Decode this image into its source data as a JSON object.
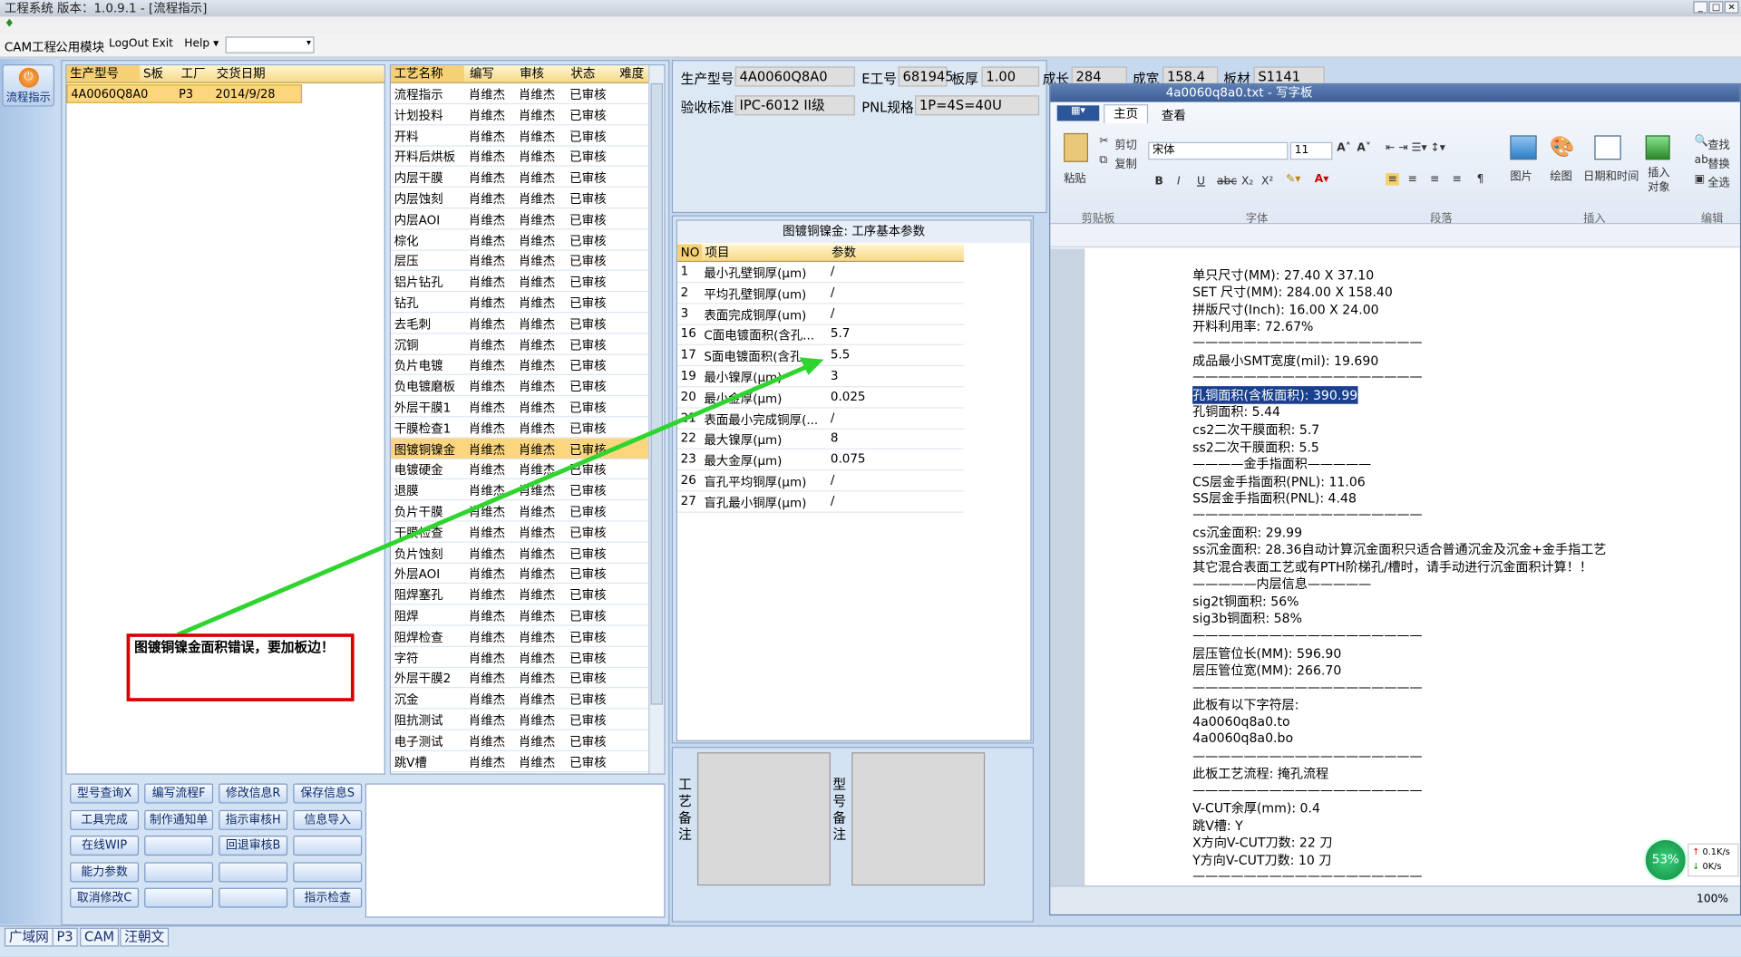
{
  "window": {
    "title": "工程系统    版本：1.0.9.1 - [流程指示]"
  },
  "menu": [
    "CAM工程",
    "公用模块",
    "LogOut",
    "Exit",
    "Help ▾"
  ],
  "sidebar": {
    "flow_button": "流程指示"
  },
  "order_grid": {
    "headers": [
      "生产型号",
      "S板",
      "工厂",
      "交货日期"
    ],
    "rows": [
      [
        "4A0060Q8A0",
        "",
        "P3",
        "2014/9/28"
      ]
    ]
  },
  "process_grid": {
    "headers": [
      "工艺名称",
      "编写",
      "审核",
      "状态",
      "难度"
    ],
    "rows": [
      [
        "流程指示",
        "肖维杰",
        "肖维杰",
        "已审核"
      ],
      [
        "计划投料",
        "肖维杰",
        "肖维杰",
        "已审核"
      ],
      [
        "开料",
        "肖维杰",
        "肖维杰",
        "已审核"
      ],
      [
        "开料后烘板",
        "肖维杰",
        "肖维杰",
        "已审核"
      ],
      [
        "内层干膜",
        "肖维杰",
        "肖维杰",
        "已审核"
      ],
      [
        "内层蚀刻",
        "肖维杰",
        "肖维杰",
        "已审核"
      ],
      [
        "内层AOI",
        "肖维杰",
        "肖维杰",
        "已审核"
      ],
      [
        "棕化",
        "肖维杰",
        "肖维杰",
        "已审核"
      ],
      [
        "层压",
        "肖维杰",
        "肖维杰",
        "已审核"
      ],
      [
        "铝片钻孔",
        "肖维杰",
        "肖维杰",
        "已审核"
      ],
      [
        "钻孔",
        "肖维杰",
        "肖维杰",
        "已审核"
      ],
      [
        "去毛刺",
        "肖维杰",
        "肖维杰",
        "已审核"
      ],
      [
        "沉铜",
        "肖维杰",
        "肖维杰",
        "已审核"
      ],
      [
        "负片电镀",
        "肖维杰",
        "肖维杰",
        "已审核"
      ],
      [
        "负电镀磨板",
        "肖维杰",
        "肖维杰",
        "已审核"
      ],
      [
        "外层干膜1",
        "肖维杰",
        "肖维杰",
        "已审核"
      ],
      [
        "干膜检查1",
        "肖维杰",
        "肖维杰",
        "已审核"
      ],
      [
        "图镀铜镍金",
        "肖维杰",
        "肖维杰",
        "已审核"
      ],
      [
        "电镀硬金",
        "肖维杰",
        "肖维杰",
        "已审核"
      ],
      [
        "退膜",
        "肖维杰",
        "肖维杰",
        "已审核"
      ],
      [
        "负片干膜",
        "肖维杰",
        "肖维杰",
        "已审核"
      ],
      [
        "干膜检查",
        "肖维杰",
        "肖维杰",
        "已审核"
      ],
      [
        "负片蚀刻",
        "肖维杰",
        "肖维杰",
        "已审核"
      ],
      [
        "外层AOI",
        "肖维杰",
        "肖维杰",
        "已审核"
      ],
      [
        "阻焊塞孔",
        "肖维杰",
        "肖维杰",
        "已审核"
      ],
      [
        "阻焊",
        "肖维杰",
        "肖维杰",
        "已审核"
      ],
      [
        "阻焊检查",
        "肖维杰",
        "肖维杰",
        "已审核"
      ],
      [
        "字符",
        "肖维杰",
        "肖维杰",
        "已审核"
      ],
      [
        "外层干膜2",
        "肖维杰",
        "肖维杰",
        "已审核"
      ],
      [
        "沉金",
        "肖维杰",
        "肖维杰",
        "已审核"
      ],
      [
        "阻抗测试",
        "肖维杰",
        "肖维杰",
        "已审核"
      ],
      [
        "电子测试",
        "肖维杰",
        "肖维杰",
        "已审核"
      ],
      [
        "跳V槽",
        "肖维杰",
        "肖维杰",
        "已审核"
      ]
    ],
    "selected": "图镀铜镍金"
  },
  "buttons": [
    [
      "型号查询X",
      "编写流程F",
      "修改信息R",
      "保存信息S"
    ],
    [
      "工具完成",
      "制作通知单",
      "指示审核H",
      "信息导入"
    ],
    [
      "在线WIP",
      "",
      "回退审核B",
      ""
    ],
    [
      "能力参数",
      "",
      "",
      ""
    ],
    [
      "取消修改C",
      "",
      "",
      "指示检查"
    ]
  ],
  "info": {
    "model_label": "生产型号",
    "model": "4A0060Q8A0",
    "eno_label": "E工号",
    "eno": "681945",
    "thick_label": "板厚",
    "thick": "1.00",
    "len_label": "成长",
    "len": "284",
    "width_label": "成宽",
    "width": "158.4",
    "mat_label": "板材",
    "mat": "S1141",
    "std_label": "验收标准",
    "std": "IPC-6012 II级",
    "pnl_label": "PNL规格",
    "pnl": "1P=4S=40U"
  },
  "params": {
    "title": "图镀铜镍金: 工序基本参数",
    "headers": [
      "NO",
      "项目",
      "参数"
    ],
    "rows": [
      [
        "1",
        "最小孔壁铜厚(μm)",
        "/"
      ],
      [
        "2",
        "平均孔壁铜厚(um)",
        "/"
      ],
      [
        "3",
        "表面完成铜厚(um)",
        "/"
      ],
      [
        "16",
        "C面电镀面积(含孔...",
        "5.7"
      ],
      [
        "17",
        "S面电镀面积(含孔...",
        "5.5"
      ],
      [
        "19",
        "最小镍厚(μm)",
        "3"
      ],
      [
        "20",
        "最小金厚(μm)",
        "0.025"
      ],
      [
        "21",
        "表面最小完成铜厚(...",
        "/"
      ],
      [
        "22",
        "最大镍厚(μm)",
        "8"
      ],
      [
        "23",
        "最大金厚(μm)",
        "0.075"
      ],
      [
        "26",
        "盲孔平均铜厚(μm)",
        "/"
      ],
      [
        "27",
        "盲孔最小铜厚(μm)",
        "/"
      ]
    ]
  },
  "remarks": {
    "process": "工艺备注",
    "model": "型号备注"
  },
  "annotation": "图镀铜镍金面积错误，要加板边！",
  "wordpad": {
    "title": "4a0060q8a0.txt - 写字板",
    "tabs": [
      "主页",
      "查看"
    ],
    "clipboard": {
      "paste": "粘贴",
      "cut": "剪切",
      "copy": "复制",
      "group": "剪贴板"
    },
    "font": {
      "name": "宋体",
      "size": "11",
      "group": "字体"
    },
    "paragraph": "段落",
    "insert": {
      "pic": "图片",
      "draw": "绘图",
      "datetime": "日期和时间",
      "obj": "插入对象",
      "group": "插入"
    },
    "edit": {
      "find": "查找",
      "replace": "替换",
      "all": "全选",
      "group": "编辑"
    },
    "zoom": "100%",
    "lines": [
      "单只尺寸(MM): 27.40 X 37.10",
      "SET 尺寸(MM): 284.00 X 158.40",
      "拼版尺寸(Inch): 16.00 X 24.00",
      "开料利用率: 72.67%",
      "——————————————————",
      "成品最小SMT宽度(mil): 19.690",
      "——————————————————",
      "孔铜面积(含板面积): 390.99",
      "孔铜面积: 5.44",
      "cs2二次干膜面积: 5.7",
      "ss2二次干膜面积: 5.5",
      "————金手指面积—————",
      "CS层金手指面积(PNL): 11.06",
      "SS层金手指面积(PNL): 4.48",
      "——————————————————",
      "cs沉金面积: 29.99",
      "ss沉金面积: 28.36自动计算沉金面积只适合普通沉金及沉金+金手指工艺",
      "其它混合表面工艺或有PTH阶梯孔/槽时，请手动进行沉金面积计算！！",
      "—————内层信息—————",
      "sig2t铜面积: 56%",
      "sig3b铜面积: 58%",
      "——————————————————",
      "层压管位长(MM): 596.90",
      "层压管位宽(MM): 266.70",
      "——————————————————",
      "此板有以下字符层:",
      "4a0060q8a0.to",
      "4a0060q8a0.bo",
      "——————————————————",
      "此板工艺流程: 掩孔流程",
      "——————————————————",
      "V-CUT余厚(mm): 0.4",
      "跳V槽: Y",
      "X方向V-CUT刀数: 22 刀",
      "Y方向V-CUT刀数: 10 刀",
      "——————————————————"
    ]
  },
  "net": {
    "percent": "53%",
    "up": "0.1K/s",
    "down": "0K/s"
  },
  "status_tabs": [
    "广域网",
    "P3",
    "CAM",
    "汪朝文"
  ]
}
